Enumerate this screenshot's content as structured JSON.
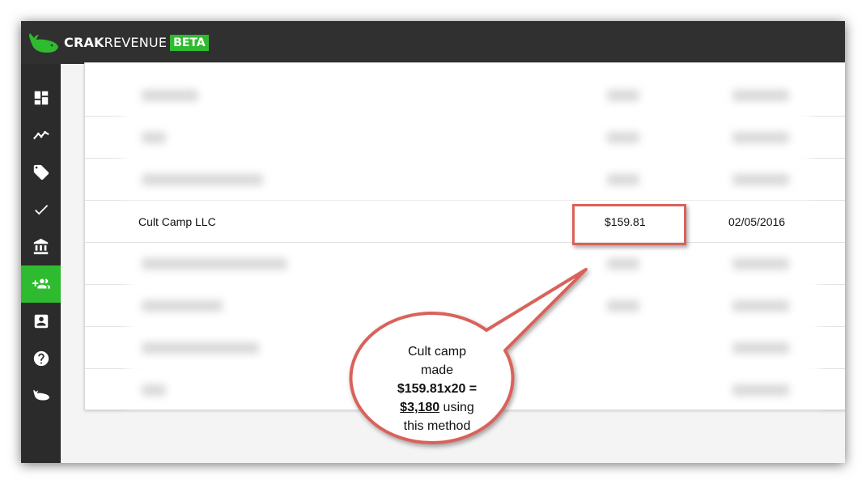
{
  "app": {
    "brand_bold": "CRAK",
    "brand_rest": "REVENUE",
    "badge": "BETA"
  },
  "sidebar": {
    "items": [
      {
        "icon": "dashboard-icon",
        "active": false
      },
      {
        "icon": "trending-line-icon",
        "active": false
      },
      {
        "icon": "tag-icon",
        "active": false
      },
      {
        "icon": "check-icon",
        "active": false
      },
      {
        "icon": "bank-icon",
        "active": false
      },
      {
        "icon": "add-group-icon",
        "active": true
      },
      {
        "icon": "contact-card-icon",
        "active": false
      },
      {
        "icon": "help-icon",
        "active": false
      },
      {
        "icon": "whale-icon",
        "active": false
      }
    ]
  },
  "table": {
    "highlighted_row": {
      "name": "Cult Camp LLC",
      "amount": "$159.81",
      "date": "02/05/2016"
    }
  },
  "callout": {
    "line1": "Cult camp",
    "line2": "made",
    "line3": "$159.81x20 =",
    "line4_bold": "$3,180",
    "line4_rest": " using",
    "line5": "this method"
  },
  "colors": {
    "accent": "#2fbb2f",
    "topbar": "#303030",
    "sidebar": "#2b2b2b",
    "annotation": "#d9625a"
  }
}
